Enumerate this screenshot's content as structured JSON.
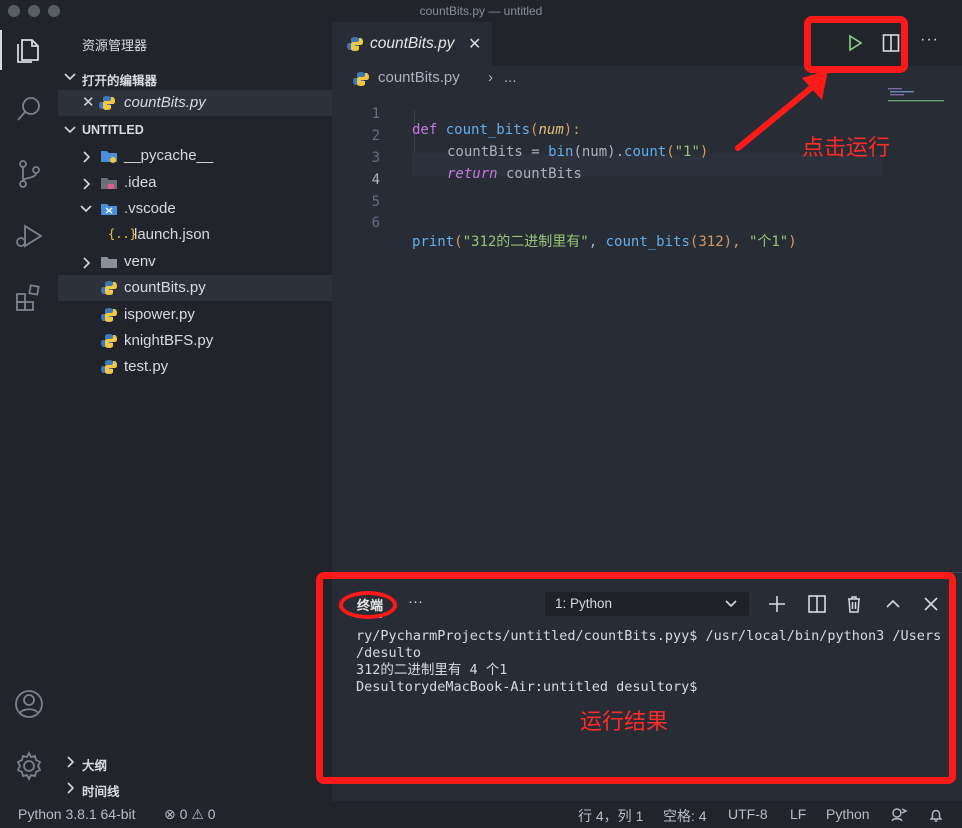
{
  "window": {
    "title": "countBits.py — untitled"
  },
  "sidebar": {
    "title": "资源管理器",
    "open_editors": {
      "label": "打开的编辑器",
      "items": [
        {
          "label": "countBits.py"
        }
      ]
    },
    "folder": {
      "label": "UNTITLED",
      "items": [
        {
          "label": "__pycache__",
          "kind": "folder",
          "expanded": false
        },
        {
          "label": ".idea",
          "kind": "folder",
          "expanded": false
        },
        {
          "label": ".vscode",
          "kind": "folder",
          "expanded": true
        },
        {
          "label": "launch.json",
          "kind": "json-file"
        },
        {
          "label": "venv",
          "kind": "folder",
          "expanded": false
        },
        {
          "label": "countBits.py",
          "kind": "python-file",
          "selected": true
        },
        {
          "label": "ispower.py",
          "kind": "python-file"
        },
        {
          "label": "knightBFS.py",
          "kind": "python-file"
        },
        {
          "label": "test.py",
          "kind": "python-file"
        }
      ]
    },
    "outline": {
      "label": "大纲"
    },
    "timeline": {
      "label": "时间线"
    }
  },
  "editor": {
    "tab": {
      "label": "countBits.py"
    },
    "breadcrumb": {
      "file": "countBits.py",
      "rest": "..."
    },
    "line_numbers": [
      "1",
      "2",
      "3",
      "4",
      "5",
      "6"
    ],
    "code": {
      "l1_kw": "def",
      "l1_fn": "count_bits",
      "l1_p1": "(",
      "l1_param": "num",
      "l1_p2": "):",
      "l2_var": "countBits = ",
      "l2_fn1": "bin",
      "l2_mid": "(num).",
      "l2_fn2": "count",
      "l2_p1": "(",
      "l2_str": "\"1\"",
      "l2_p2": ")",
      "l3_kw": "return",
      "l3_var": " countBits",
      "l6_fn": "print",
      "l6_p1": "(",
      "l6_str1": "\"312的二进制里有\"",
      "l6_c1": ", ",
      "l6_fn2": "count_bits",
      "l6_p2": "(",
      "l6_num": "312",
      "l6_p3": "), ",
      "l6_str2": "\"个1\"",
      "l6_p4": ")"
    }
  },
  "annotations": {
    "run": "点击运行",
    "result": "运行结果"
  },
  "panel": {
    "tab": "终端",
    "terminal_select": "1: Python",
    "output": [
      "ry/PycharmProjects/untitled/countBits.pyy$ /usr/local/bin/python3 /Users",
      "/desulto",
      "312的二进制里有 4 个1",
      "DesultorydeMacBook-Air:untitled desultory$"
    ]
  },
  "statusbar": {
    "interpreter": "Python 3.8.1 64-bit",
    "errors": "0",
    "warnings": "0",
    "position": "行 4，列 1",
    "spaces": "空格: 4",
    "encoding": "UTF-8",
    "eol": "LF",
    "language": "Python"
  },
  "colors": {
    "highlight": "#ff1a1a",
    "background": "#282c34",
    "sidebar": "#21252b"
  }
}
